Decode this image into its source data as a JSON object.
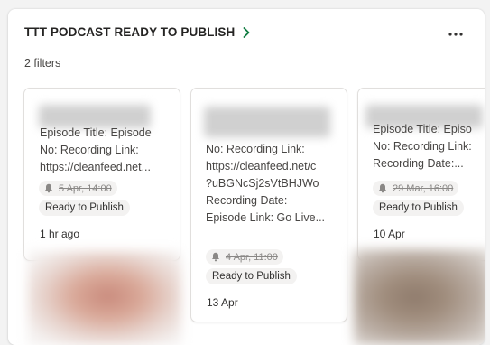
{
  "header": {
    "title": "TTT PODCAST READY TO PUBLISH",
    "filters_label": "2 filters"
  },
  "icons": {
    "title_chevron": "chevron-right-icon",
    "more": "more-horizontal-icon",
    "reminder": "bell-icon"
  },
  "colors": {
    "chevron": "#107c41",
    "badge_bg": "#f3f2f1"
  },
  "cards": [
    {
      "description": "Episode Title: Episode\nNo: Recording Link:\nhttps://cleanfeed.net...",
      "reminder_date": "5 Apr, 14:00",
      "label": "Ready to Publish",
      "meta": "1 hr ago"
    },
    {
      "description": "No: Recording Link:\nhttps://cleanfeed.net/c\n?uBGNcSj2sVtBHJWo\nRecording Date:\nEpisode Link: Go Live...",
      "reminder_date": "4 Apr, 11:00",
      "label": "Ready to Publish",
      "meta": "13 Apr"
    },
    {
      "description": "Episode Title: Episo\nNo: Recording Link:\nRecording Date:...",
      "reminder_date": "29 Mar, 16:00",
      "label": "Ready to Publish",
      "meta": "10 Apr"
    }
  ]
}
